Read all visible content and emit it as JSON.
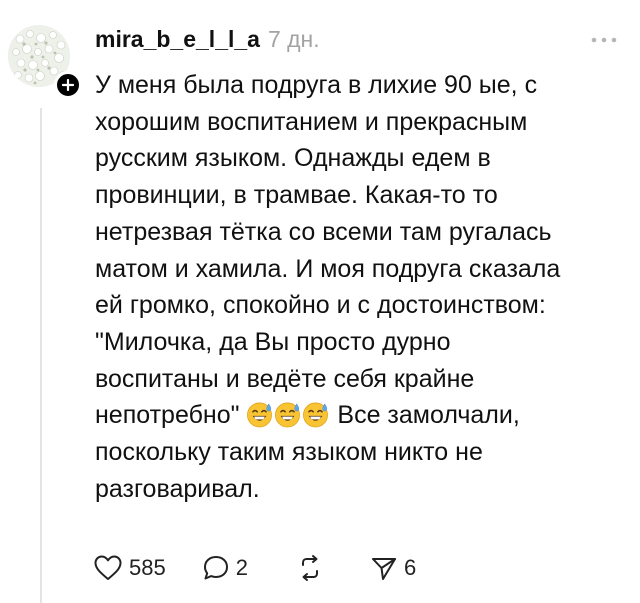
{
  "post": {
    "author": "mira_b_e_l_l_a",
    "time": "7 дн.",
    "body_lines": [
      "У меня была подруга в лихие 90 ые, с",
      "хорошим  воспитанием и прекрасным",
      "русским языком. Однажды едем в",
      "провинции, в трамвае.  Какая-то то",
      "нетрезвая тётка со всеми там ругалась",
      "матом и хамила. И моя подруга сказала",
      "ей громко, спокойно и с достоинством:",
      "\"Милочка, да Вы просто дурно",
      "воспитаны и ведёте себя крайне"
    ],
    "line_10_before": "непотребно\"",
    "line_10_after": "Все замолчали,",
    "emoji_name": "grinning-face-with-sweat-icon",
    "body_lines_tail": [
      "поскольку таким языком никто не",
      "разговаривал."
    ]
  },
  "actions": {
    "likes": "585",
    "replies": "2",
    "reposts": "",
    "shares": "6"
  },
  "colors": {
    "text": "#111111",
    "muted": "#a3a3a3",
    "thread_line": "#e4e4e4",
    "badge": "#000000"
  }
}
